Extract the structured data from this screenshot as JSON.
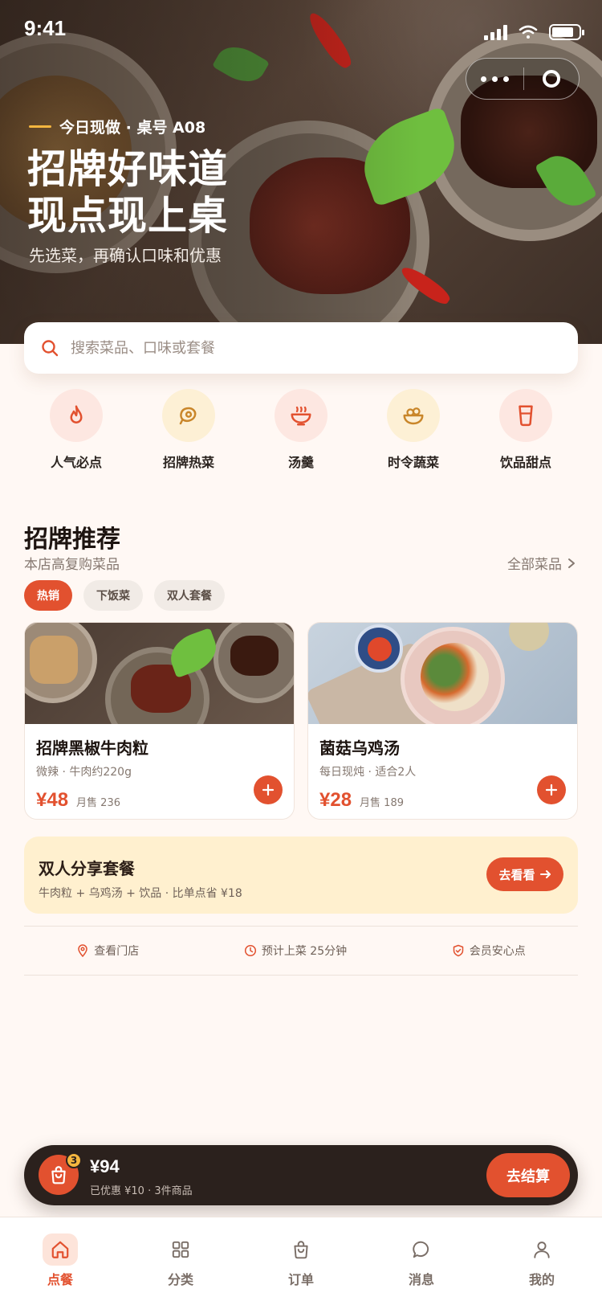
{
  "status_bar": {
    "time": "9:41"
  },
  "hero": {
    "tag": "今日现做 · 桌号 A08",
    "title_line1": "招牌好味道",
    "title_line2": "现点现上桌",
    "subtitle": "先选菜，再确认口味和优惠"
  },
  "search": {
    "placeholder": "搜索菜品、口味或套餐"
  },
  "categories": [
    {
      "label": "人气必点",
      "icon": "flame-icon",
      "bg": "#fde7e1",
      "color": "#e2512f"
    },
    {
      "label": "招牌热菜",
      "icon": "steak-icon",
      "bg": "#fdf0d5",
      "color": "#c9862a"
    },
    {
      "label": "汤羹",
      "icon": "soup-bowl-icon",
      "bg": "#fde7e1",
      "color": "#e2512f"
    },
    {
      "label": "时令蔬菜",
      "icon": "salad-icon",
      "bg": "#fdf0d5",
      "color": "#c9862a"
    },
    {
      "label": "饮品甜点",
      "icon": "cup-icon",
      "bg": "#fde7e1",
      "color": "#e2512f"
    }
  ],
  "section": {
    "title": "招牌推荐",
    "subtitle": "本店高复购菜品",
    "more": "全部菜品"
  },
  "chips": [
    {
      "label": "热销",
      "active": true
    },
    {
      "label": "下饭菜",
      "active": false
    },
    {
      "label": "双人套餐",
      "active": false
    }
  ],
  "dishes": [
    {
      "name": "招牌黑椒牛肉粒",
      "desc": "微辣 · 牛肉约220g",
      "price": "¥48",
      "sold": "月售 236"
    },
    {
      "name": "菌菇乌鸡汤",
      "desc": "每日现炖 · 适合2人",
      "price": "¥28",
      "sold": "月售 189"
    }
  ],
  "combo": {
    "title": "双人分享套餐",
    "desc": "牛肉粒 + 乌鸡汤 + 饮品 · 比单点省 ¥18",
    "button": "去看看"
  },
  "info": [
    {
      "label": "查看门店",
      "icon": "location-pin-icon"
    },
    {
      "label": "预计上菜 25分钟",
      "icon": "clock-icon"
    },
    {
      "label": "会员安心点",
      "icon": "shield-check-icon"
    }
  ],
  "cart": {
    "count": "3",
    "total": "¥94",
    "detail": "已优惠 ¥10 · 3件商品",
    "checkout": "去结算"
  },
  "tabs": [
    {
      "label": "点餐",
      "icon": "home-icon",
      "active": true
    },
    {
      "label": "分类",
      "icon": "grid-icon",
      "active": false
    },
    {
      "label": "订单",
      "icon": "bag-icon",
      "active": false
    },
    {
      "label": "消息",
      "icon": "chat-icon",
      "active": false
    },
    {
      "label": "我的",
      "icon": "user-icon",
      "active": false
    }
  ],
  "colors": {
    "accent": "#e2512f",
    "gold": "#f4b63f",
    "background": "#fff8f4",
    "cart_bar": "#2b211d",
    "combo_bg": "#fff0cf"
  }
}
